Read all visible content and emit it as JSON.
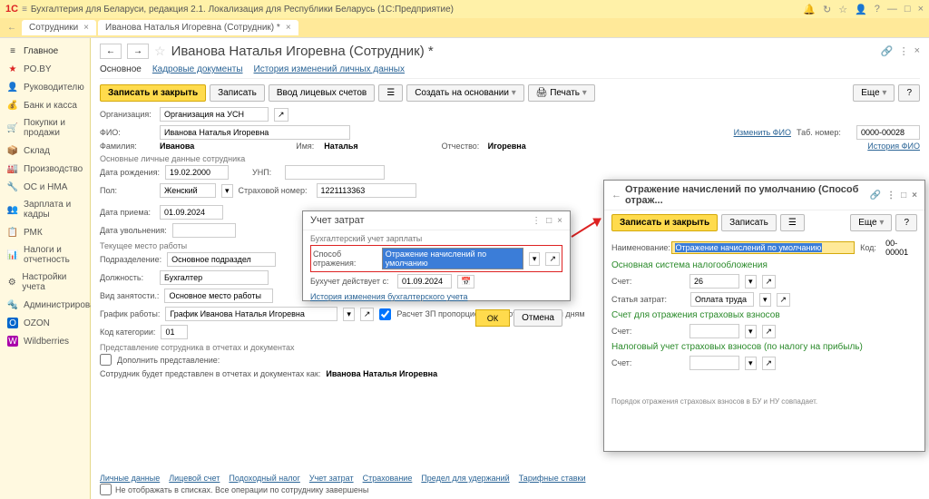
{
  "titleBar": {
    "appName": "Бухгалтерия для Беларуси, редакция 2.1. Локализация для Республики Беларусь  (1С:Предприятие)",
    "logo": "1С"
  },
  "tabs": [
    {
      "label": "Сотрудники",
      "closable": true
    },
    {
      "label": "Иванова Наталья Игоревна (Сотрудник) *",
      "closable": true
    }
  ],
  "sidebar": [
    {
      "icon": "≡",
      "label": "Главное",
      "color": "#333"
    },
    {
      "icon": "★",
      "label": "PO.BY",
      "color": "#d22"
    },
    {
      "icon": "👤",
      "label": "Руководителю",
      "color": "#888"
    },
    {
      "icon": "💰",
      "label": "Банк и касса",
      "color": "#c90"
    },
    {
      "icon": "🛒",
      "label": "Покупки и продажи",
      "color": "#d22"
    },
    {
      "icon": "📦",
      "label": "Склад",
      "color": "#888"
    },
    {
      "icon": "🏭",
      "label": "Производство",
      "color": "#888"
    },
    {
      "icon": "🔧",
      "label": "ОС и НМА",
      "color": "#2a8"
    },
    {
      "icon": "👥",
      "label": "Зарплата и кадры",
      "color": "#28a"
    },
    {
      "icon": "📋",
      "label": "РМК",
      "color": "#888"
    },
    {
      "icon": "📊",
      "label": "Налоги и отчетность",
      "color": "#888"
    },
    {
      "icon": "⚙",
      "label": "Настройки учета",
      "color": "#888"
    },
    {
      "icon": "🔩",
      "label": "Администрирование",
      "color": "#888"
    },
    {
      "icon": "O",
      "label": "OZON",
      "color": "#06c"
    },
    {
      "icon": "W",
      "label": "Wildberries",
      "color": "#a0a"
    }
  ],
  "page": {
    "title": "Иванова Наталья Игоревна (Сотрудник) *",
    "subTabs": [
      "Основное",
      "Кадровые документы",
      "История изменений личных данных"
    ],
    "activeSubTab": 0
  },
  "toolbar": {
    "saveClose": "Записать и закрыть",
    "save": "Записать",
    "accounts": "Ввод лицевых счетов",
    "createBased": "Создать на основании",
    "print": "Печать",
    "more": "Еще",
    "help": "?"
  },
  "form": {
    "org": {
      "label": "Организация:",
      "value": "Организация на УСН"
    },
    "fio": {
      "label": "ФИО:",
      "value": "Иванова Наталья Игоревна",
      "changeLink": "Изменить ФИО",
      "historyLink": "История ФИО"
    },
    "tabNum": {
      "label": "Таб. номер:",
      "value": "0000-00028"
    },
    "surname": {
      "label": "Фамилия:",
      "value": "Иванова"
    },
    "name": {
      "label": "Имя:",
      "value": "Наталья"
    },
    "patronymic": {
      "label": "Отчество:",
      "value": "Игоревна"
    },
    "personalSection": "Основные личные данные сотрудника",
    "birthDate": {
      "label": "Дата рождения:",
      "value": "19.02.2000"
    },
    "unp": {
      "label": "УНП:",
      "value": ""
    },
    "gender": {
      "label": "Пол:",
      "value": "Женский"
    },
    "insNum": {
      "label": "Страховой номер:",
      "value": "1221113363"
    },
    "hireDate": {
      "label": "Дата приема:",
      "value": "01.09.2024"
    },
    "fireDate": {
      "label": "Дата увольнения:",
      "value": ""
    },
    "currentPlace": "Текущее место работы",
    "subdivision": {
      "label": "Подразделение:",
      "value": "Основное подраздел"
    },
    "position": {
      "label": "Должность:",
      "value": "Бухгалтер"
    },
    "employType": {
      "label": "Вид занятости.:",
      "value": "Основное место работы"
    },
    "schedule": {
      "label": "График работы:",
      "value": "График Иванова Наталья Игоревна"
    },
    "propCalc": "Расчет ЗП пропорционально отработанным дням",
    "category": {
      "label": "Код категории:",
      "value": "01"
    },
    "reprSection": "Представление сотрудника в отчетах и документах",
    "supplement": "Дополнить представление:",
    "reprNote": "Сотрудник будет представлен в отчетах и документах как:",
    "reprValue": "Иванова Наталья Игоревна"
  },
  "bottomLinks": [
    "Личные данные",
    "Лицевой счет",
    "Подоходный налог",
    "Учет затрат",
    "Страхование",
    "Предел для удержаний",
    "Тарифные ставки"
  ],
  "bottomCheck": "Не отображать в списках. Все операции по сотруднику завершены",
  "modalCosts": {
    "title": "Учет затрат",
    "salarySection": "Бухгалтерский учет зарплаты",
    "reflectMethod": {
      "label": "Способ отражения:",
      "value": "Отражение начислений по умолчанию"
    },
    "buhDate": {
      "label": "Бухучет действует с:",
      "value": "01.09.2024"
    },
    "historyLink": "История изменения бухгалтерского учета",
    "ok": "ОК",
    "cancel": "Отмена"
  },
  "modalReflect": {
    "title": "Отражение начислений по умолчанию (Способ отраж...",
    "saveClose": "Записать и закрыть",
    "save": "Записать",
    "more": "Еще",
    "help": "?",
    "nameLabel": "Наименование:",
    "nameValue": "Отражение начислений по умолчанию",
    "codeLabel": "Код:",
    "codeValue": "00-00001",
    "taxSection": "Основная система налогообложения",
    "account": {
      "label": "Счет:",
      "value": "26"
    },
    "costItem": {
      "label": "Статья затрат:",
      "value": "Оплата труда"
    },
    "insSection": "Счет для отражения страховых взносов",
    "insAccount": {
      "label": "Счет:",
      "value": ""
    },
    "taxInsSection": "Налоговый учет страховых взносов (по налогу на прибыль)",
    "taxInsAccount": {
      "label": "Счет:",
      "value": ""
    },
    "note": "Порядок отражения страховых взносов в БУ и НУ совпадает."
  }
}
